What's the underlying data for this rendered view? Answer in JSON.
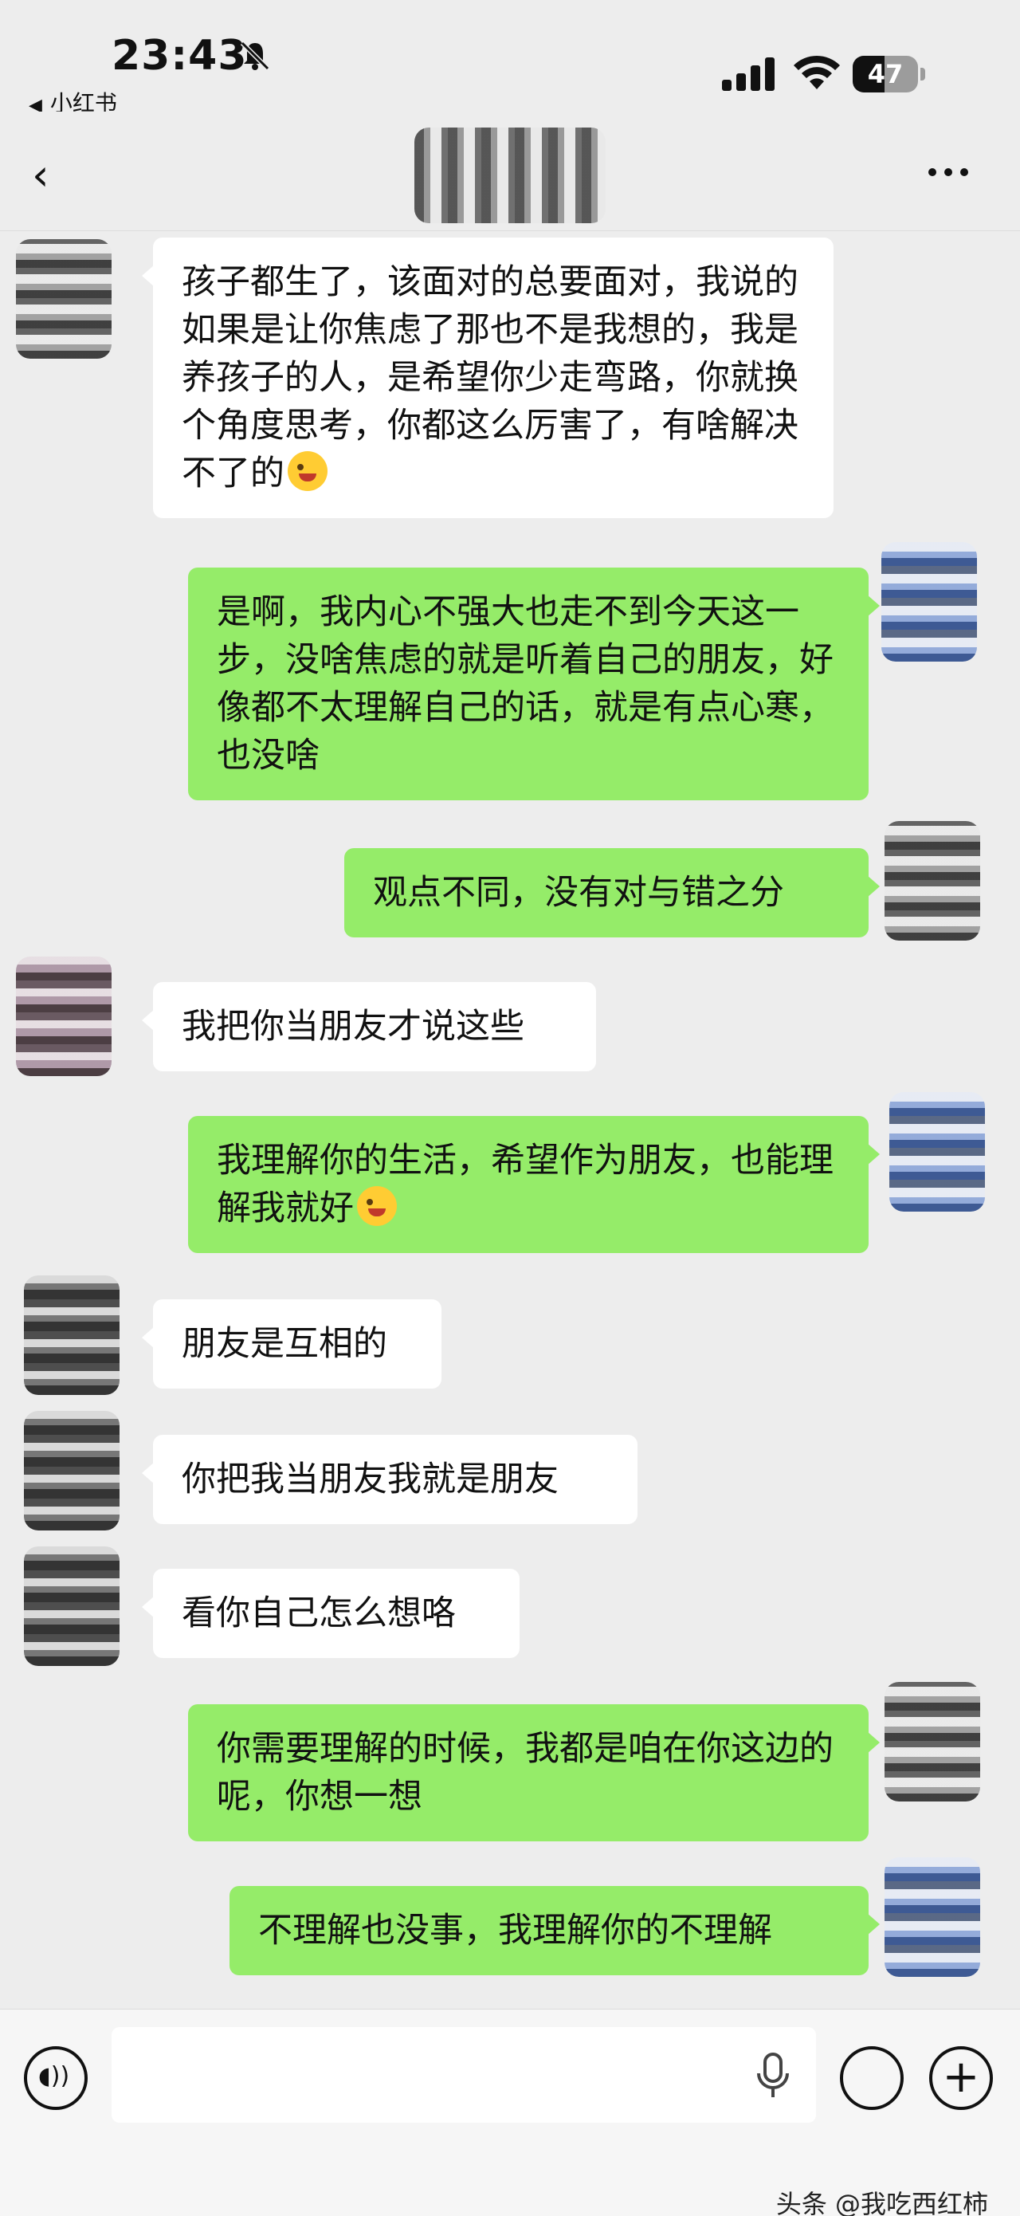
{
  "status_bar": {
    "time": "23:43",
    "back_app": "小红书",
    "battery": "47"
  },
  "messages": [
    {
      "side": "in",
      "text": "孩子都生了，该面对的总要面对，我说的如果是让你焦虑了那也不是我想的，我是养孩子的人，是希望你少走弯路，你就换个角度思考，你都这么厉害了，有啥解决不了的",
      "emoji": "winking-face"
    },
    {
      "side": "out",
      "text": "是啊，我内心不强大也走不到今天这一步，没啥焦虑的就是听着自己的朋友，好像都不太理解自己的话，就是有点心寒，也没啥"
    },
    {
      "side": "out",
      "text": "观点不同，没有对与错之分"
    },
    {
      "side": "in",
      "text": "我把你当朋友才说这些"
    },
    {
      "side": "out",
      "text": "我理解你的生活，希望作为朋友，也能理解我就好",
      "emoji": "winking-face"
    },
    {
      "side": "in",
      "text": "朋友是互相的"
    },
    {
      "side": "in",
      "text": "你把我当朋友我就是朋友"
    },
    {
      "side": "in",
      "text": "看你自己怎么想咯"
    },
    {
      "side": "out",
      "text": "你需要理解的时候，我都是咱在你这边的呢，你想一想"
    },
    {
      "side": "out",
      "text": "不理解也没事，我理解你的不理解"
    }
  ],
  "watermark": "头条 @我吃西红柿",
  "colors": {
    "background": "#ededed",
    "incoming_bubble": "#ffffff",
    "outgoing_bubble": "#95ec69"
  },
  "icons": [
    "bell-slash-icon",
    "signal-icon",
    "wifi-icon",
    "battery-icon",
    "back-icon",
    "more-icon",
    "voice-icon",
    "microphone-icon",
    "emoji-icon",
    "plus-icon"
  ]
}
